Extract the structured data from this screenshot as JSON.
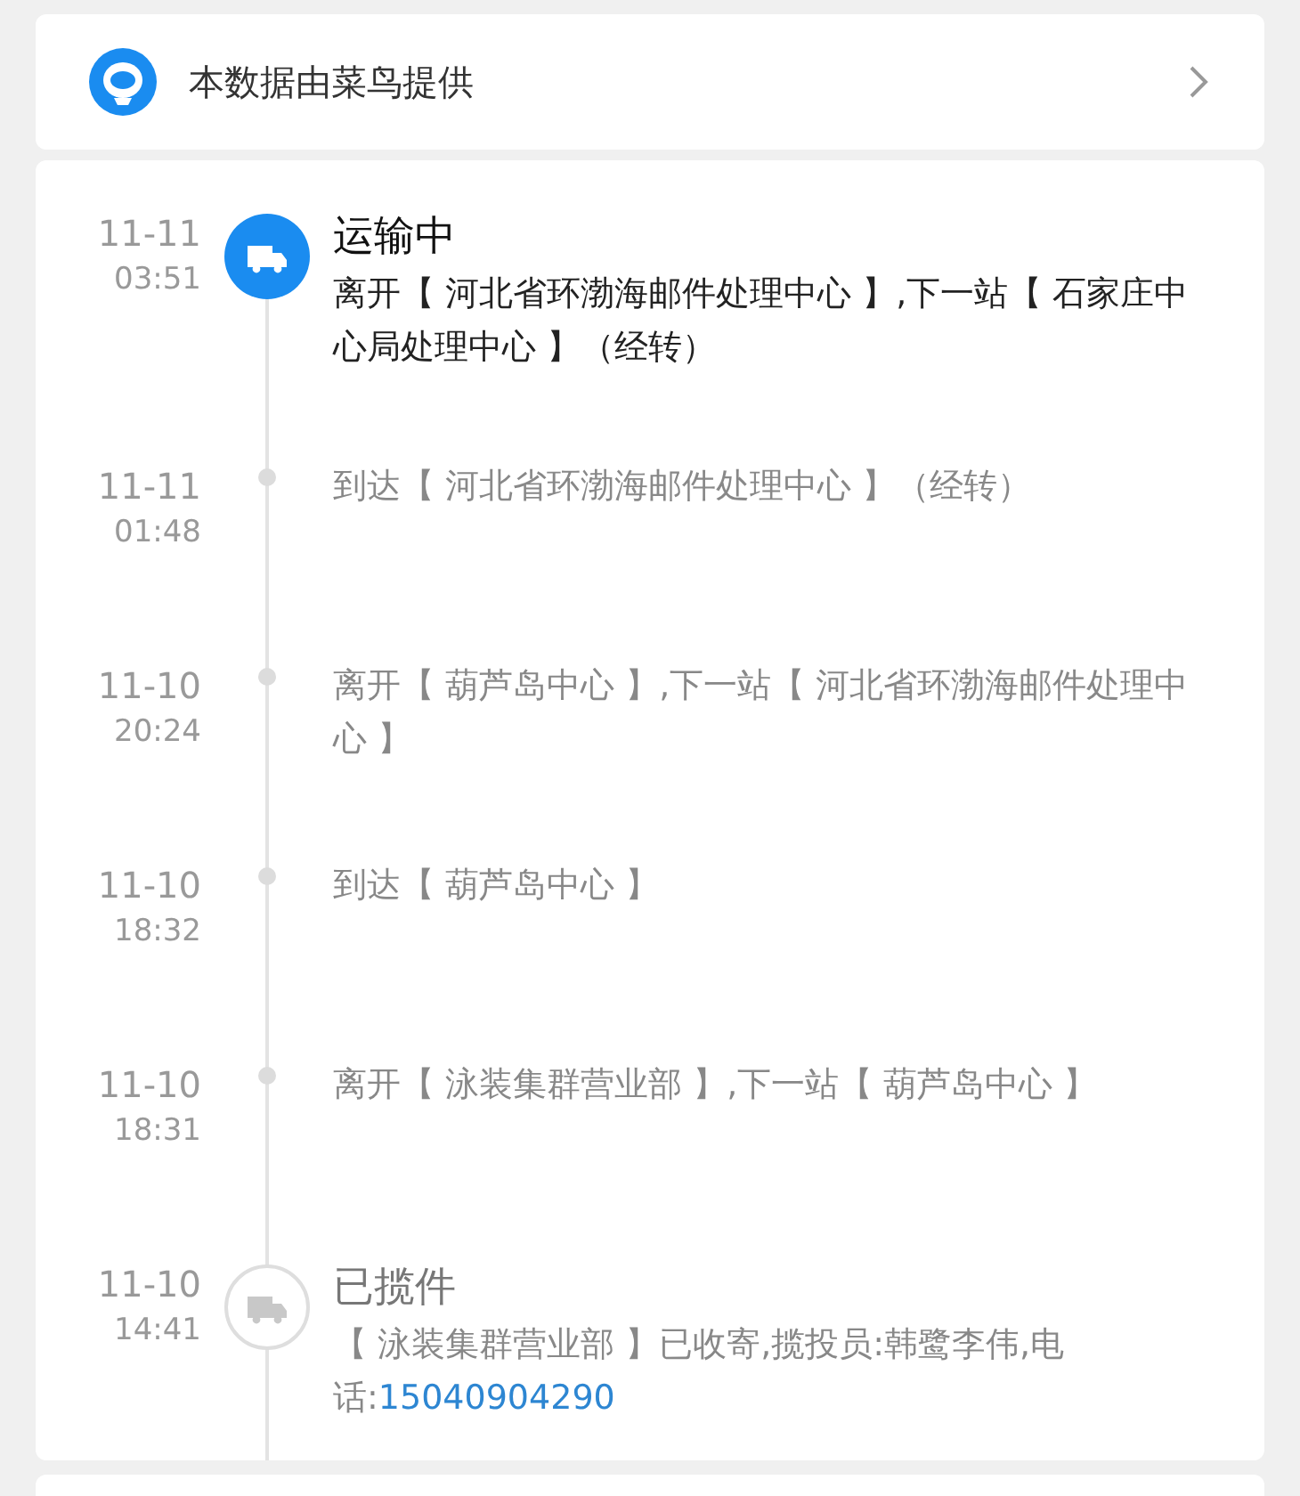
{
  "provider": {
    "text": "本数据由菜鸟提供"
  },
  "events": [
    {
      "kind": "major",
      "active": true,
      "date": "11-11",
      "time": "03:51",
      "title": "运输中",
      "description": "离开【 河北省环渤海邮件处理中心 】,下一站【 石家庄中心局处理中心 】（经转）"
    },
    {
      "kind": "minor",
      "date": "11-11",
      "time": "01:48",
      "description": "到达【 河北省环渤海邮件处理中心 】（经转）"
    },
    {
      "kind": "minor",
      "date": "11-10",
      "time": "20:24",
      "description": "离开【 葫芦岛中心 】,下一站【 河北省环渤海邮件处理中心 】"
    },
    {
      "kind": "minor",
      "date": "11-10",
      "time": "18:32",
      "description": "到达【 葫芦岛中心 】"
    },
    {
      "kind": "minor",
      "date": "11-10",
      "time": "18:31",
      "description": "离开【 泳装集群营业部 】,下一站【 葫芦岛中心 】"
    },
    {
      "kind": "major",
      "active": false,
      "date": "11-10",
      "time": "14:41",
      "title": "已揽件",
      "description": "【 泳装集群营业部 】已收寄,揽投员:韩鹭李伟,电话:",
      "phone": "15040904290"
    }
  ]
}
